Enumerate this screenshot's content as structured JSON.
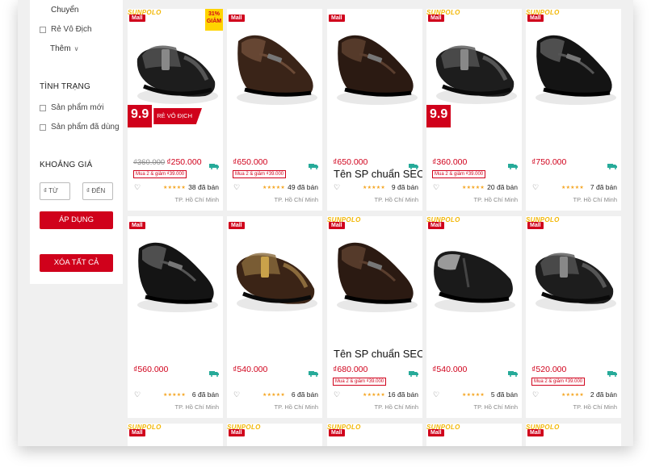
{
  "sidebar": {
    "top_link": "Chuyển",
    "seller_options": [
      "Rẻ Vô Địch"
    ],
    "more_label": "Thêm",
    "condition_title": "TÌNH TRẠNG",
    "condition_options": [
      "Sản phẩm mới",
      "Sản phẩm đã dùng"
    ],
    "price_title": "KHOẢNG GIÁ",
    "price_from_placeholder": "₫ TỪ",
    "price_to_placeholder": "₫ ĐẾN",
    "price_separator": "–",
    "apply_label": "ÁP DỤNG",
    "clear_label": "XÓA TẤT CẢ"
  },
  "colors": {
    "accent": "#d0011b",
    "star": "#f5a623",
    "badge_yellow": "#ffd400",
    "shipping": "#26aa99"
  },
  "products": [
    {
      "mall": "Mall",
      "brand": "SUNPOLO",
      "discount": "31% GIẢM",
      "promo": "9.9",
      "promo_text": "RẺ VÔ ĐỊCH",
      "shoe": "sandal-black",
      "old_price": "₫360.000",
      "price": "₫250.000",
      "deal": "Mua 2 & giảm ₫39.000",
      "seo": "",
      "stars": "★★★★★",
      "sold": "38 đã bán",
      "location": "TP. Hồ Chí Minh",
      "icon": "truck-icon"
    },
    {
      "mall": "Mall",
      "brand": "",
      "discount": "",
      "promo": "",
      "promo_text": "",
      "shoe": "loafer-brown",
      "old_price": "",
      "price": "₫650.000",
      "deal": "Mua 2 & giảm ₫39.000",
      "seo": "",
      "stars": "★★★★★",
      "sold": "49 đã bán",
      "location": "TP. Hồ Chí Minh",
      "icon": "truck-icon"
    },
    {
      "mall": "Mall",
      "brand": "",
      "discount": "",
      "promo": "",
      "promo_text": "",
      "shoe": "loafer-darkbrown",
      "old_price": "",
      "price": "₫650.000",
      "deal": "",
      "seo": "Tên SP chuẩn SEO",
      "stars": "★★★★★",
      "sold": "9 đã bán",
      "location": "TP. Hồ Chí Minh",
      "icon": "truck-icon"
    },
    {
      "mall": "Mall",
      "brand": "SUNPOLO",
      "discount": "",
      "promo": "9.9",
      "promo_text": "",
      "shoe": "sandal-black",
      "old_price": "",
      "price": "₫360.000",
      "deal": "Mua 2 & giảm ₫39.000",
      "seo": "",
      "stars": "★★★★★",
      "sold": "20 đã bán",
      "location": "TP. Hồ Chí Minh",
      "icon": "truck-icon"
    },
    {
      "mall": "Mall",
      "brand": "SUNPOLO",
      "discount": "",
      "promo": "",
      "promo_text": "",
      "shoe": "dress-black",
      "old_price": "",
      "price": "₫750.000",
      "deal": "",
      "seo": "",
      "stars": "★★★★★",
      "sold": "7 đã bán",
      "location": "TP. Hồ Chí Minh",
      "icon": "truck-icon"
    },
    {
      "mall": "Mall",
      "brand": "",
      "discount": "",
      "promo": "",
      "promo_text": "",
      "shoe": "dress-black",
      "old_price": "",
      "price": "₫560.000",
      "deal": "",
      "seo": "",
      "stars": "★★★★★",
      "sold": "6 đã bán",
      "location": "TP. Hồ Chí Minh",
      "icon": "truck-icon"
    },
    {
      "mall": "Mall",
      "brand": "",
      "discount": "",
      "promo": "",
      "promo_text": "",
      "shoe": "sandal-brown",
      "old_price": "",
      "price": "₫540.000",
      "deal": "",
      "seo": "",
      "stars": "★★★★★",
      "sold": "6 đã bán",
      "location": "TP. Hồ Chí Minh",
      "icon": "truck-icon"
    },
    {
      "mall": "Mall",
      "brand": "SUNPOLO",
      "discount": "",
      "promo": "",
      "promo_text": "",
      "shoe": "loafer-darkbrown",
      "old_price": "",
      "price": "₫680.000",
      "deal": "Mua 2 & giảm ₫39.000",
      "seo": "Tên SP chuẩn SEO",
      "stars": "★★★★★",
      "sold": "16 đã bán",
      "location": "TP. Hồ Chí Minh",
      "icon": "truck-icon"
    },
    {
      "mall": "Mall",
      "brand": "SUNPOLO",
      "discount": "",
      "promo": "",
      "promo_text": "",
      "shoe": "clog-black",
      "old_price": "",
      "price": "₫540.000",
      "deal": "",
      "seo": "",
      "stars": "★★★★★",
      "sold": "5 đã bán",
      "location": "TP. Hồ Chí Minh",
      "icon": "truck-icon"
    },
    {
      "mall": "Mall",
      "brand": "SUNPOLO",
      "discount": "",
      "promo": "",
      "promo_text": "",
      "shoe": "sandal-black",
      "old_price": "",
      "price": "₫520.000",
      "deal": "Mua 2 & giảm ₫39.000",
      "seo": "",
      "stars": "★★★★★",
      "sold": "2 đã bán",
      "location": "TP. Hồ Chí Minh",
      "icon": "truck-icon"
    },
    {
      "mall": "Mall",
      "brand": "SUNPOLO"
    },
    {
      "mall": "Mall",
      "brand": "SUNPOLO"
    },
    {
      "mall": "Mall",
      "brand": "SUNPOLO"
    },
    {
      "mall": "Mall",
      "brand": "SUNPOLO"
    },
    {
      "mall": "Mall",
      "brand": "SUNPOLO"
    }
  ]
}
